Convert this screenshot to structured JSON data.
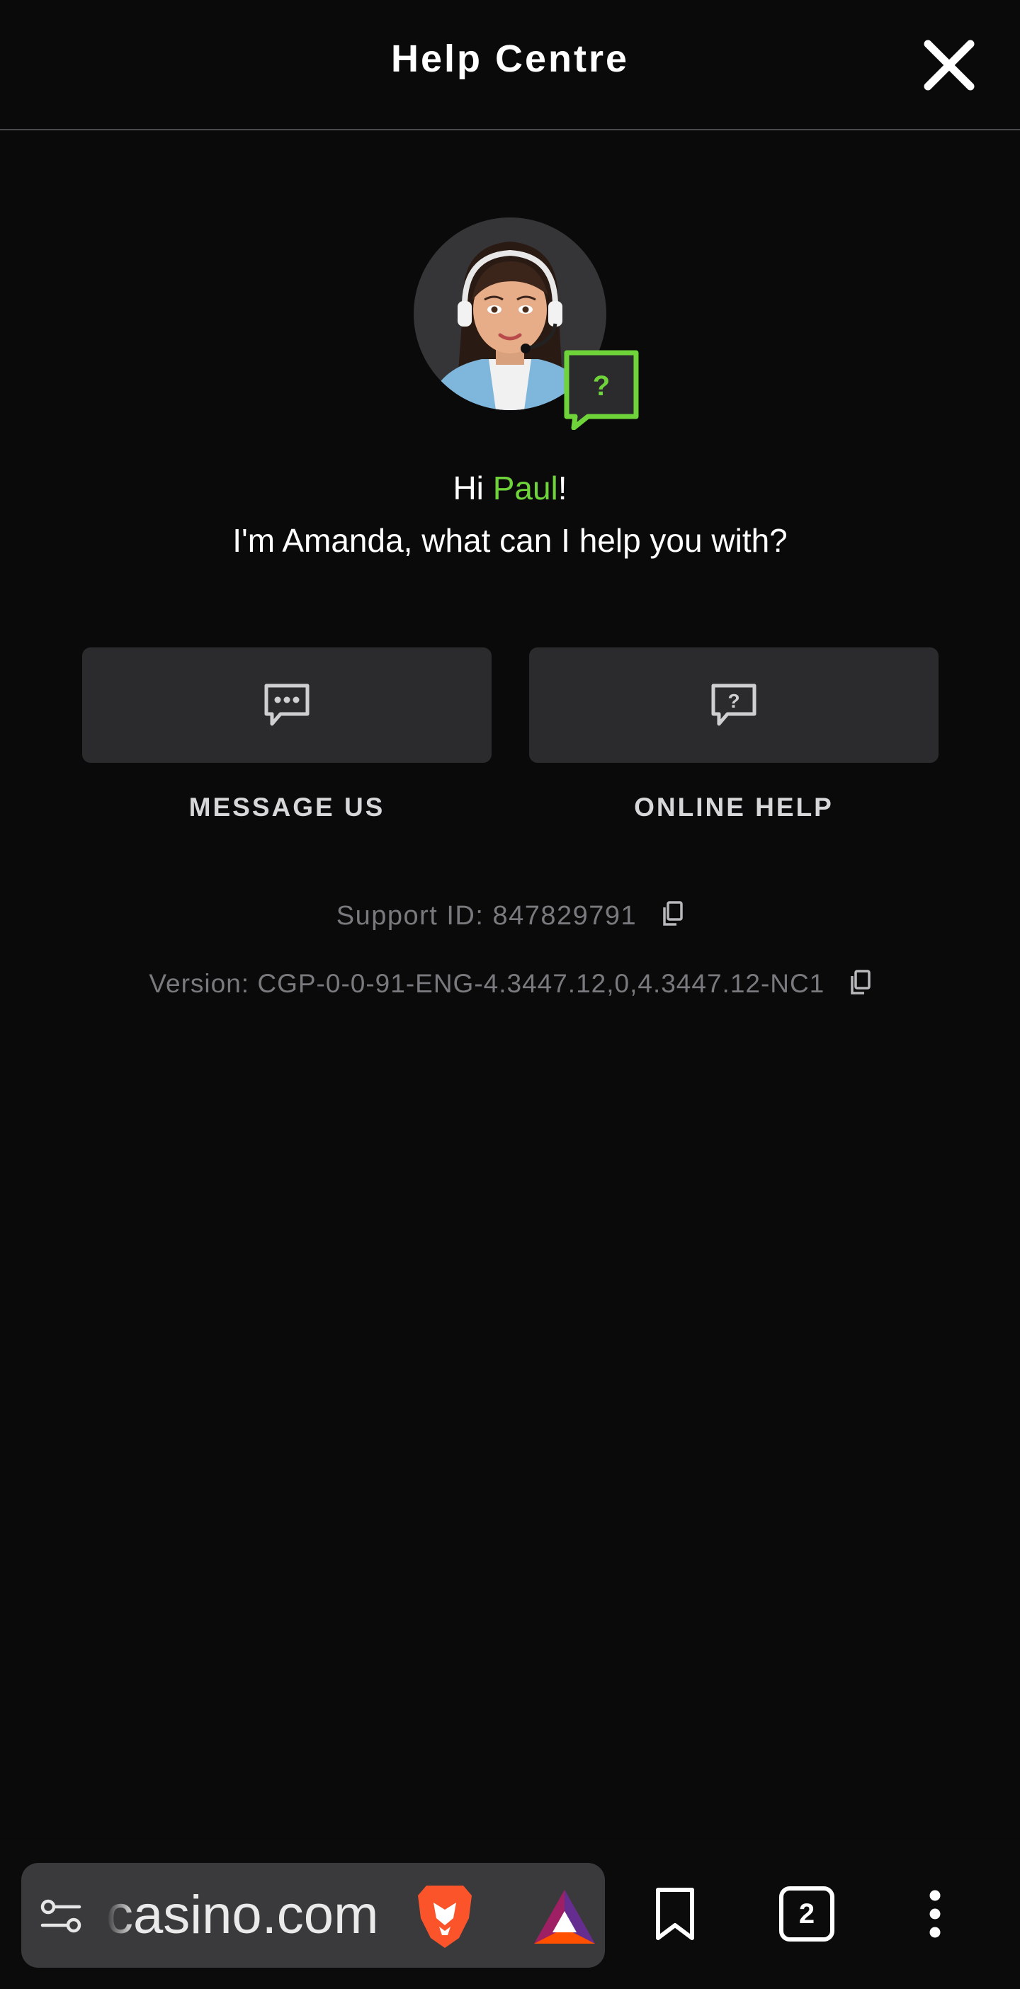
{
  "header": {
    "title": "Help Centre",
    "close_icon": "close-icon"
  },
  "agent": {
    "avatar_icon": "support-agent-avatar",
    "badge_icon": "help-chat-bubble-icon",
    "badge_symbol": "?"
  },
  "greeting": {
    "hi": "Hi ",
    "name": "Paul",
    "exclaim": "!",
    "line2": "I'm Amanda, what can I help you with?"
  },
  "actions": {
    "message_us": {
      "label": "MESSAGE US",
      "icon": "chat-dots-icon"
    },
    "online_help": {
      "label": "ONLINE HELP",
      "icon": "chat-question-icon",
      "symbol": "?"
    }
  },
  "info": {
    "support_id": "Support ID: 847829791",
    "version": "Version: CGP-0-0-91-ENG-4.3447.12,0,4.3447.12-NC1"
  },
  "browser": {
    "url": "casino.com",
    "tab_count": "2",
    "icons": [
      "site-settings-icon",
      "brave-lion-icon",
      "bat-rewards-icon",
      "bookmark-icon",
      "tabs-icon",
      "more-menu-icon"
    ]
  },
  "colors": {
    "background": "#0a0a0b",
    "accent": "#6fd33a",
    "button": "#2b2b2d",
    "muted_text": "#7a7a7e"
  }
}
